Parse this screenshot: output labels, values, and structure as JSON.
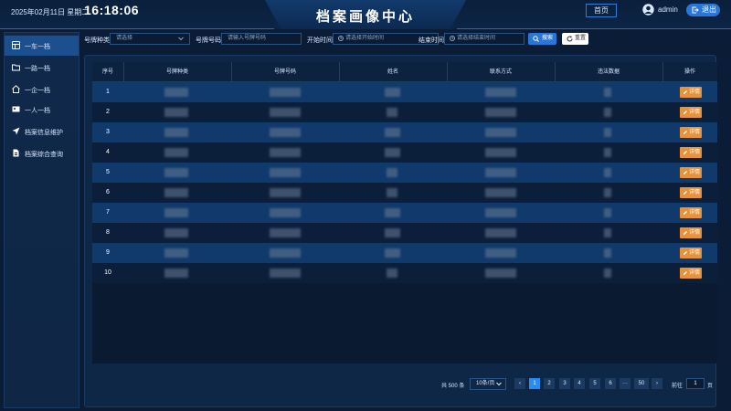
{
  "header": {
    "date": "2025年02月11日 星期二",
    "time": "16:18:06",
    "title": "档案画像中心",
    "home_label": "首页",
    "user_name": "admin",
    "logout_label": "退出"
  },
  "sidebar": {
    "items": [
      {
        "label": "一车一档",
        "icon": "car-file-icon",
        "active": true
      },
      {
        "label": "一路一档",
        "icon": "folder-icon",
        "active": false
      },
      {
        "label": "一企一档",
        "icon": "home-icon",
        "active": false
      },
      {
        "label": "一人一档",
        "icon": "id-card-icon",
        "active": false
      },
      {
        "label": "档案信息维护",
        "icon": "send-icon",
        "active": false
      },
      {
        "label": "档案综合查询",
        "icon": "document-icon",
        "active": false
      }
    ]
  },
  "filters": {
    "plate_type_label": "号牌种类",
    "plate_type_placeholder": "请选择",
    "plate_number_label": "号牌号码",
    "plate_number_placeholder": "请输入号牌号码",
    "start_time_label": "开始时间",
    "start_time_placeholder": "请选择开始时间",
    "end_time_label": "结束时间",
    "end_time_placeholder": "请选择结束时间",
    "search_label": "搜索",
    "reset_label": "重置"
  },
  "table": {
    "headers": [
      "序号",
      "号牌种类",
      "号牌号码",
      "姓名",
      "联系方式",
      "违法数据",
      "操作"
    ],
    "rows": [
      {
        "index": "1"
      },
      {
        "index": "2"
      },
      {
        "index": "3"
      },
      {
        "index": "4"
      },
      {
        "index": "5"
      },
      {
        "index": "6"
      },
      {
        "index": "7"
      },
      {
        "index": "8"
      },
      {
        "index": "9"
      },
      {
        "index": "10"
      }
    ],
    "action_label": "详情"
  },
  "pagination": {
    "total_text": "共 500 条",
    "page_size": "10条/页",
    "pages": [
      "1",
      "2",
      "3",
      "4",
      "5",
      "6",
      "···",
      "50"
    ],
    "current_page": "1",
    "prev_symbol": "‹",
    "next_symbol": "›",
    "goto_label": "前往",
    "goto_value": "1",
    "goto_unit": "页"
  },
  "colors": {
    "accent": "#2a76d6",
    "detail_button": "#e8923a",
    "row_highlight": "#103a6b",
    "page_background": "#0b1d36"
  }
}
